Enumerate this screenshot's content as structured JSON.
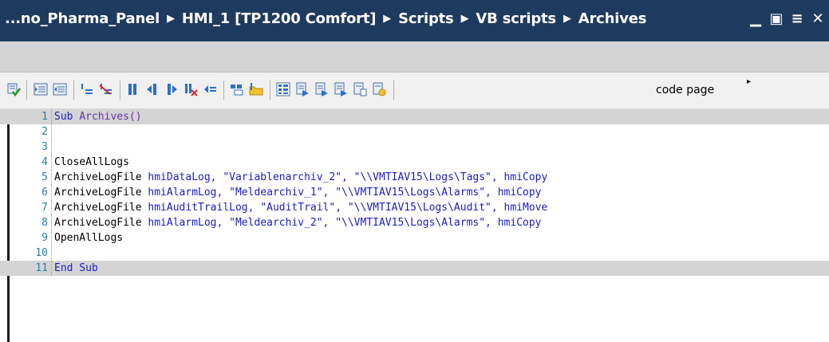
{
  "window": {
    "breadcrumb": [
      "...no_Pharma_Panel",
      "HMI_1 [TP1200 Comfort]",
      "Scripts",
      "VB scripts",
      "Archives"
    ],
    "separator": "▶",
    "controls": {
      "minimize": "▁",
      "restore": "▣",
      "menu": "≡",
      "close": "✕"
    }
  },
  "toolbar": {
    "code_page_label": "code page",
    "overflow_arrow": "▸"
  },
  "editor": {
    "lines": [
      {
        "n": "1",
        "text": "Sub Archives()"
      },
      {
        "n": "2",
        "text": ""
      },
      {
        "n": "3",
        "text": ""
      },
      {
        "n": "4",
        "text": "CloseAllLogs"
      },
      {
        "n": "5",
        "text": "ArchiveLogFile hmiDataLog, \"Variablenarchiv_2\", \"\\\\VMTIAV15\\Logs\\Tags\", hmiCopy"
      },
      {
        "n": "6",
        "text": "ArchiveLogFile hmiAlarmLog, \"Meldearchiv_1\", \"\\\\VMTIAV15\\Logs\\Alarms\", hmiCopy"
      },
      {
        "n": "7",
        "text": "ArchiveLogFile hmiAuditTrailLog, \"AuditTrail\", \"\\\\VMTIAV15\\Logs\\Audit\", hmiMove"
      },
      {
        "n": "8",
        "text": "ArchiveLogFile hmiAlarmLog, \"Meldearchiv_2\", \"\\\\VMTIAV15\\Logs\\Alarms\", hmiCopy"
      },
      {
        "n": "9",
        "text": "OpenAllLogs"
      },
      {
        "n": "10",
        "text": ""
      },
      {
        "n": "11",
        "text": "End Sub"
      }
    ],
    "highlighted_lines": [
      "1",
      "11"
    ],
    "colors": {
      "keyword": "#1a1acc",
      "function": "#6b2fa3",
      "line_number": "#2b7fa6",
      "highlight": "#d4d4d4"
    }
  }
}
